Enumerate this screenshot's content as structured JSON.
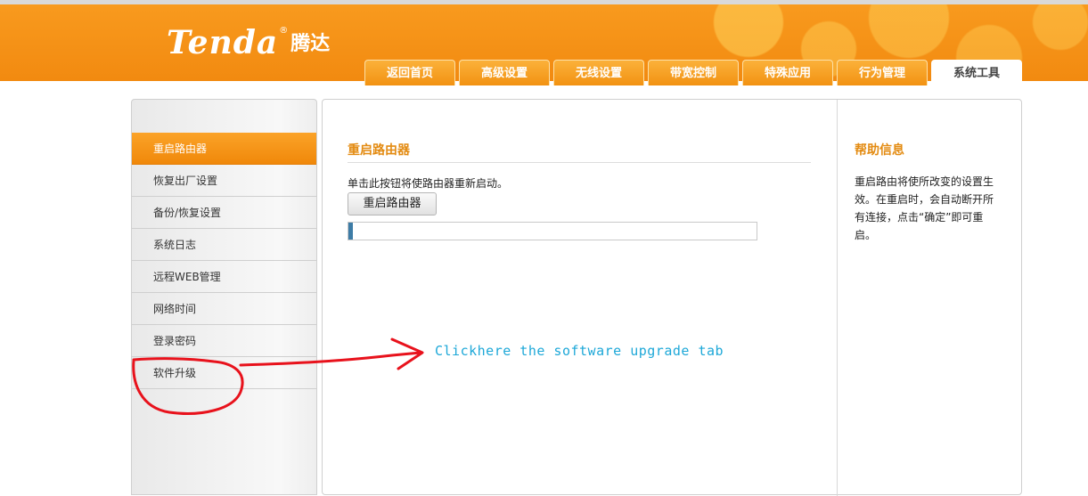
{
  "brand": {
    "name_en": "Tenda",
    "reg_mark": "®",
    "name_cn": "腾达"
  },
  "tabs": [
    {
      "label": "返回首页",
      "active": false
    },
    {
      "label": "高级设置",
      "active": false
    },
    {
      "label": "无线设置",
      "active": false
    },
    {
      "label": "带宽控制",
      "active": false
    },
    {
      "label": "特殊应用",
      "active": false
    },
    {
      "label": "行为管理",
      "active": false
    },
    {
      "label": "系统工具",
      "active": true
    }
  ],
  "sidebar": {
    "items": [
      {
        "label": "重启路由器",
        "active": true
      },
      {
        "label": "恢复出厂设置",
        "active": false
      },
      {
        "label": "备份/恢复设置",
        "active": false
      },
      {
        "label": "系统日志",
        "active": false
      },
      {
        "label": "远程WEB管理",
        "active": false
      },
      {
        "label": "网络时间",
        "active": false
      },
      {
        "label": "登录密码",
        "active": false
      },
      {
        "label": "软件升级",
        "active": false
      }
    ]
  },
  "main": {
    "title": "重启路由器",
    "description": "单击此按钮将使路由器重新启动。",
    "reboot_button": "重启路由器",
    "progress_fraction": 0.01
  },
  "help": {
    "title": "帮助信息",
    "text": "重启路由将使所改变的设置生效。在重启时，会自动断开所有连接，点击“确定”即可重启。"
  },
  "annotation": {
    "text": "Clickhere the software upgrade tab",
    "color": "#1ea8d8",
    "scribble_color": "#e8121c"
  },
  "colors": {
    "accent": "#f7931e",
    "title_orange": "#e38b12",
    "progress": "#3d7ca6"
  }
}
